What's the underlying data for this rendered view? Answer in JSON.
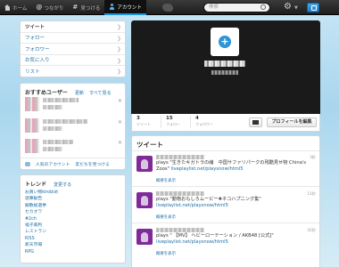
{
  "topbar": {
    "nav": [
      {
        "label": "ホーム",
        "icon": "home-icon"
      },
      {
        "label": "つながり",
        "icon": "at-icon"
      },
      {
        "label": "見つける",
        "icon": "hash-icon"
      },
      {
        "label": "アカウント",
        "icon": "user-icon"
      }
    ],
    "search_placeholder": "検索"
  },
  "menu": {
    "items": [
      "ツイート",
      "フォロー",
      "フォロワー",
      "お気に入り",
      "リスト"
    ]
  },
  "who_to_follow": {
    "title": "おすすめユーザー",
    "refresh": "更新",
    "view_all": "すべて見る",
    "footer_left": "人気のアカウント",
    "footer_right": "友だちを見つける"
  },
  "trends": {
    "title": "トレンド",
    "change": "変更する",
    "items": [
      "お買い物kirobiめ",
      "退陣勧告",
      "解散総選挙",
      "セカオワ",
      "#2ch",
      "福子裁判",
      "レストラン",
      "KISS",
      "新天市場",
      "RPG"
    ]
  },
  "profile": {
    "stats": [
      {
        "num": "3",
        "label": "ツイート"
      },
      {
        "num": "15",
        "label": "フォロー"
      },
      {
        "num": "4",
        "label": "フォロワー"
      }
    ],
    "edit_button": "プロフィールを編集"
  },
  "tweets": {
    "title": "ツイート",
    "items": [
      {
        "time": "3秒",
        "text": "plays \"生きたキガトラの緒　中国サファリパークの残酷見せ物 China's Zoos\"",
        "link": "liveplaylist.net/playsnow/html5",
        "expand": "概要を表示"
      },
      {
        "time": "11秒",
        "text": "plays \"動物おもしろムービー✚ネコハプニング集\"",
        "link": "liveplaylist.net/playsnow/html5",
        "expand": "概要を表示"
      },
      {
        "time": "41秒",
        "text": "plays \" 【MV】 ヘビーローテーション / AKB48 [公式]\"",
        "link": "liveplaylist.net/playsnow/html5",
        "expand": "概要を表示"
      }
    ]
  }
}
